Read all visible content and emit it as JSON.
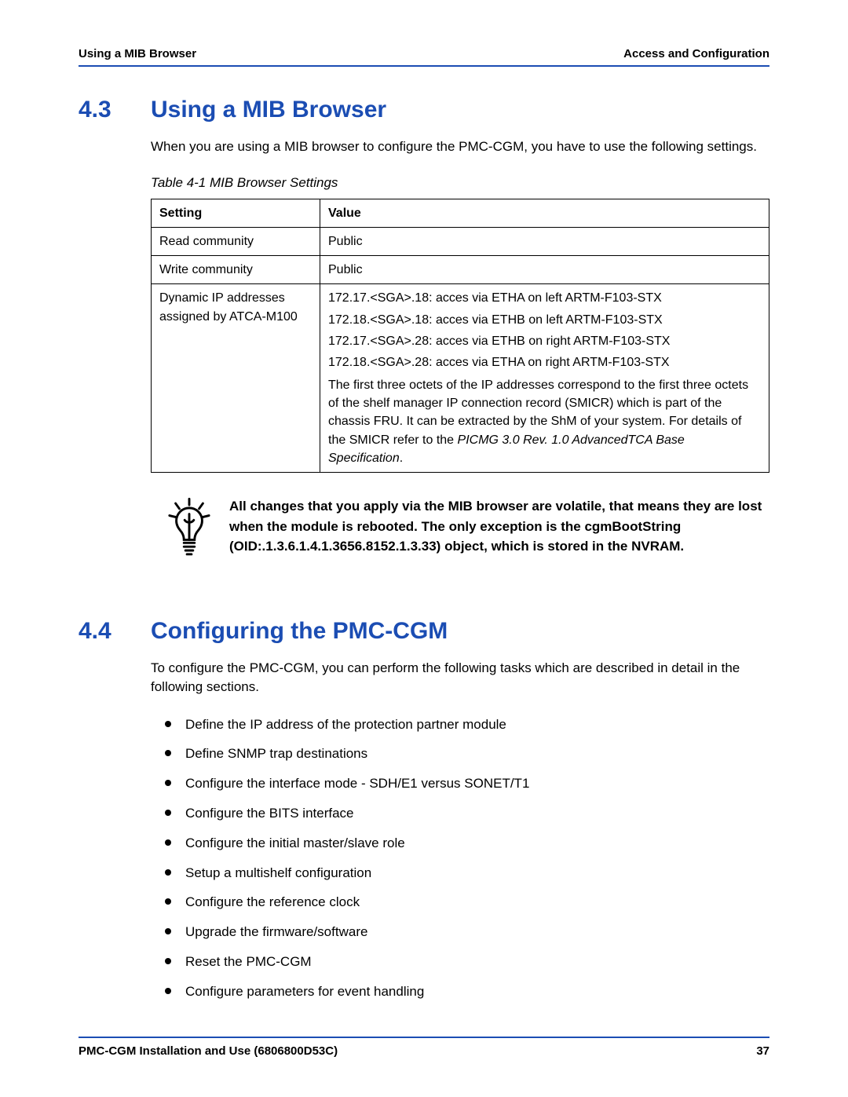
{
  "header": {
    "left": "Using a MIB Browser",
    "right": "Access and Configuration"
  },
  "section43": {
    "num": "4.3",
    "title": "Using a MIB Browser",
    "intro": "When you are using a MIB browser to configure the PMC-CGM, you have to use the following settings.",
    "table_caption": "Table 4-1 MIB Browser Settings",
    "th1": "Setting",
    "th2": "Value",
    "rows": {
      "r0": {
        "setting": "Read community",
        "value": "Public"
      },
      "r1": {
        "setting": "Write community",
        "value": "Public"
      },
      "r2": {
        "setting_l1": "Dynamic IP addresses",
        "setting_l2": "assigned by ATCA-M100",
        "ip0": "172.17.<SGA>.18: acces via ETHA  on left ARTM-F103-STX",
        "ip1": "172.18.<SGA>.18: acces via ETHB  on left ARTM-F103-STX",
        "ip2": "172.17.<SGA>.28: acces via ETHB  on right ARTM-F103-STX",
        "ip3": "172.18.<SGA>.28: acces via ETHA  on right ARTM-F103-STX",
        "explain_a": "The first three octets of the IP addresses correspond to the first three octets of the shelf manager IP connection record (SMICR) which is part of the chassis FRU. It can be extracted by the ShM of your system. For details of the SMICR refer to the ",
        "explain_italic": "PICMG 3.0 Rev. 1.0 AdvancedTCA Base Specification",
        "explain_b": "."
      }
    },
    "note": "All changes that you apply via the MIB browser are volatile, that means they are lost when the module is rebooted. The only exception is the cgmBootString (OID:.1.3.6.1.4.1.3656.8152.1.3.33) object, which is stored in the NVRAM."
  },
  "section44": {
    "num": "4.4",
    "title": "Configuring the PMC-CGM",
    "intro": "To configure the PMC-CGM, you can perform the following tasks which are described in detail in the following sections.",
    "tasks": {
      "0": "Define the IP address of the protection partner module",
      "1": "Define SNMP trap destinations",
      "2": "Configure the interface mode - SDH/E1 versus SONET/T1",
      "3": "Configure the BITS interface",
      "4": "Configure the initial master/slave role",
      "5": "Setup a multishelf configuration",
      "6": "Configure the reference clock",
      "7": "Upgrade the firmware/software",
      "8": "Reset the PMC-CGM",
      "9": "Configure parameters for event handling"
    }
  },
  "footer": {
    "left": "PMC-CGM Installation and Use (6806800D53C)",
    "right": "37"
  }
}
